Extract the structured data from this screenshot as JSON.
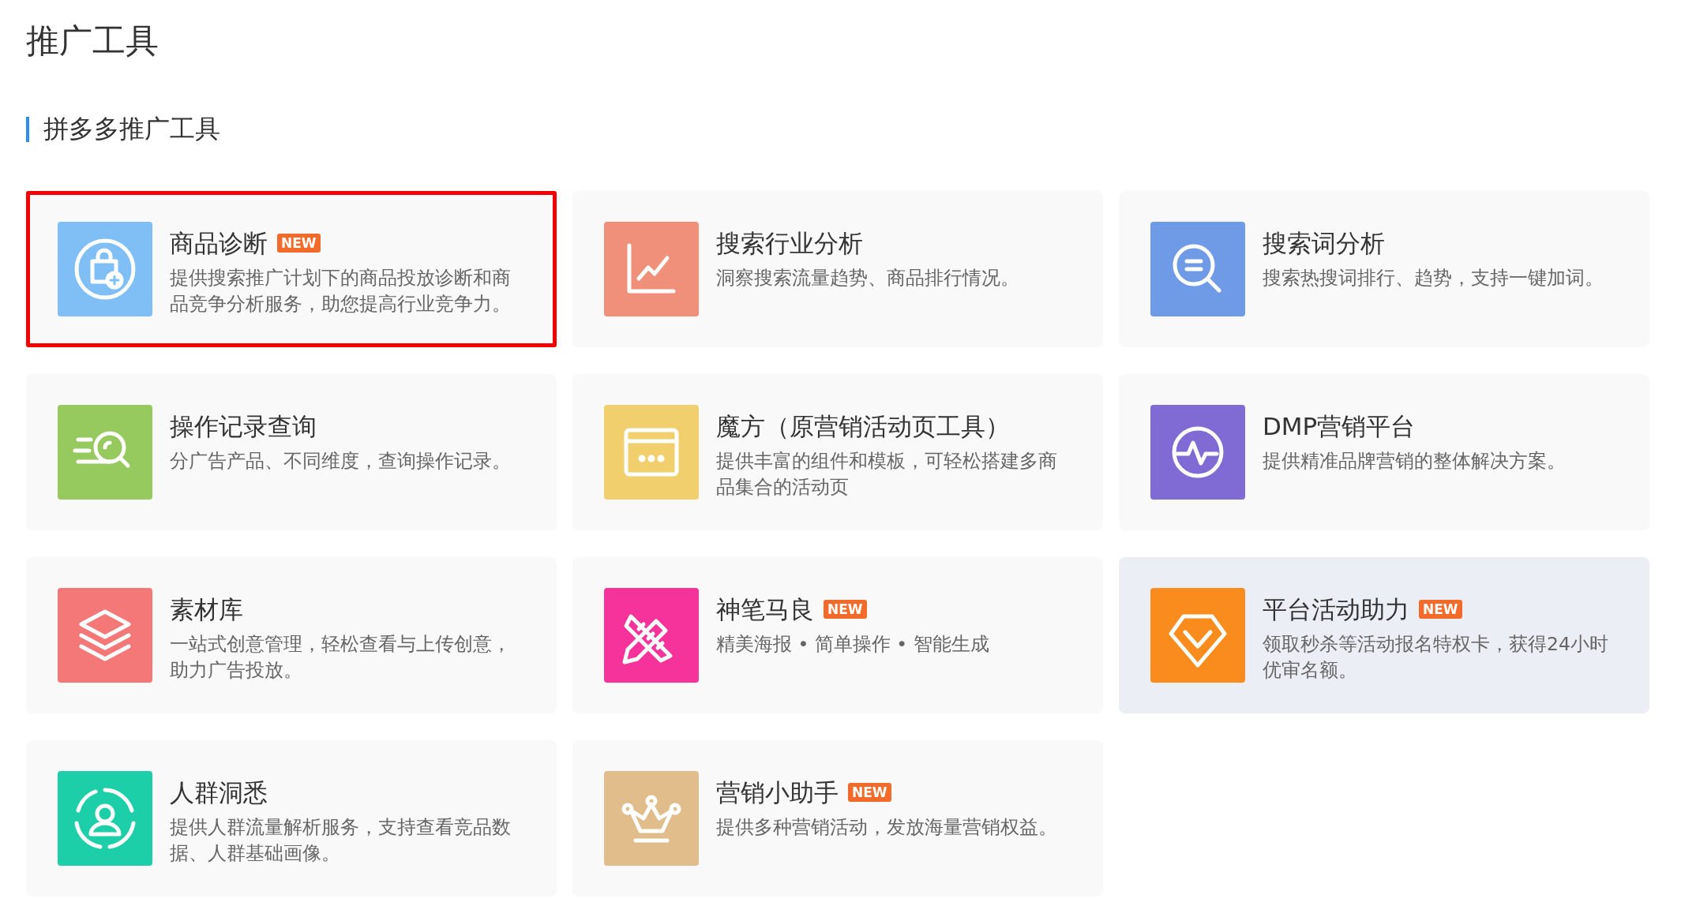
{
  "page_title": "推广工具",
  "section_title": "拼多多推广工具",
  "cards": [
    {
      "title": "商品诊断",
      "badge": "NEW",
      "description": "提供搜索推广计划下的商品投放诊断和商品竞争分析服务，助您提高行业竞争力。",
      "kind": "bag",
      "color": "#7fbff5",
      "highlighted": true,
      "hovered": false
    },
    {
      "title": "搜索行业分析",
      "description": "洞察搜索流量趋势、商品排行情况。",
      "kind": "chart",
      "color": "#f0907a",
      "highlighted": false,
      "hovered": false
    },
    {
      "title": "搜索词分析",
      "description": "搜索热搜词排行、趋势，支持一键加词。",
      "kind": "search",
      "color": "#6f9ae6",
      "highlighted": false,
      "hovered": false
    },
    {
      "title": "操作记录查询",
      "description": "分广告产品、不同维度，查询操作记录。",
      "kind": "records",
      "color": "#96c95e",
      "highlighted": false,
      "hovered": false
    },
    {
      "title": "魔方（原营销活动页工具）",
      "description": "提供丰富的组件和模板，可轻松搭建多商品集合的活动页",
      "kind": "window",
      "color": "#f0cf6c",
      "highlighted": false,
      "hovered": false
    },
    {
      "title": "DMP营销平台",
      "description": "提供精准品牌营销的整体解决方案。",
      "kind": "pulse",
      "color": "#7f6bd3",
      "highlighted": false,
      "hovered": false
    },
    {
      "title": "素材库",
      "description": "一站式创意管理，轻松查看与上传创意，助力广告投放。",
      "kind": "layers",
      "color": "#f57878",
      "highlighted": false,
      "hovered": false
    },
    {
      "title": "神笔马良",
      "badge": "NEW",
      "description": "精美海报 • 简单操作 • 智能生成",
      "kind": "pencil",
      "color": "#f5339a",
      "highlighted": false,
      "hovered": false
    },
    {
      "title": "平台活动助力",
      "badge": "NEW",
      "description": "领取秒杀等活动报名特权卡，获得24小时优审名额。",
      "kind": "diamond",
      "color": "#fa8c1e",
      "highlighted": false,
      "hovered": true
    },
    {
      "title": "人群洞悉",
      "description": "提供人群流量解析服务，支持查看竞品数据、人群基础画像。",
      "kind": "person",
      "color": "#1dcfa8",
      "highlighted": false,
      "hovered": false
    },
    {
      "title": "营销小助手",
      "badge": "NEW",
      "description": "提供多种营销活动，发放海量营销权益。",
      "kind": "crown",
      "color": "#e1bd8b",
      "highlighted": false,
      "hovered": false
    }
  ]
}
